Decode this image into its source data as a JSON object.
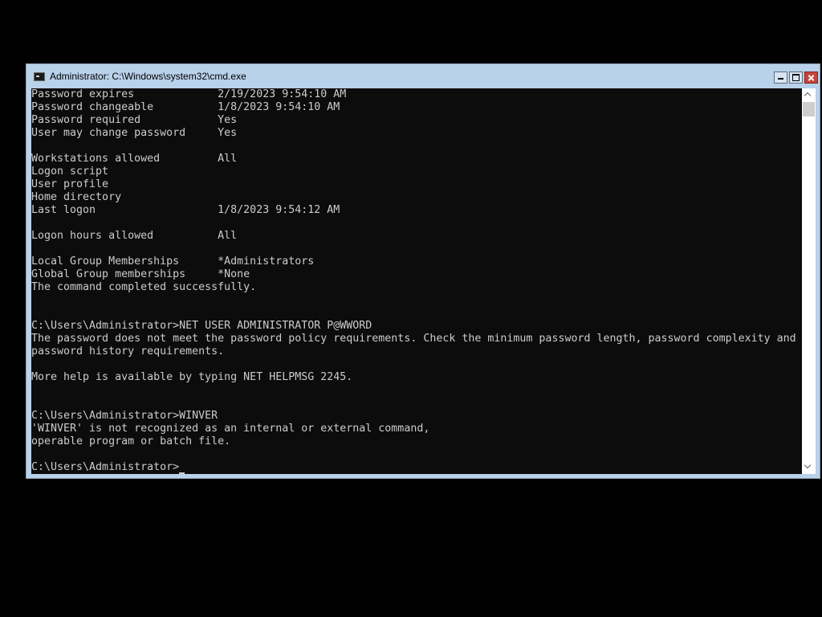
{
  "window": {
    "title": "Administrator: C:\\Windows\\system32\\cmd.exe",
    "icon": "cmd-app-icon",
    "controls": [
      "minimize-icon",
      "maximize-icon",
      "close-icon"
    ]
  },
  "console": {
    "lines": [
      "Password expires             2/19/2023 9:54:10 AM",
      "Password changeable          1/8/2023 9:54:10 AM",
      "Password required            Yes",
      "User may change password     Yes",
      "",
      "Workstations allowed         All",
      "Logon script",
      "User profile",
      "Home directory",
      "Last logon                   1/8/2023 9:54:12 AM",
      "",
      "Logon hours allowed          All",
      "",
      "Local Group Memberships      *Administrators",
      "Global Group memberships     *None",
      "The command completed successfully.",
      "",
      "",
      "C:\\Users\\Administrator>NET USER ADMINISTRATOR P@WWORD",
      "The password does not meet the password policy requirements. Check the minimum password length, password complexity and",
      "password history requirements.",
      "",
      "More help is available by typing NET HELPMSG 2245.",
      "",
      "",
      "C:\\Users\\Administrator>WINVER",
      "'WINVER' is not recognized as an internal or external command,",
      "operable program or batch file.",
      ""
    ],
    "prompt": "C:\\Users\\Administrator>"
  },
  "colors": {
    "console_bg": "#0c0c0c",
    "console_text": "#cccccc",
    "frame": "#b9d1ea",
    "close_button": "#c7443a"
  }
}
